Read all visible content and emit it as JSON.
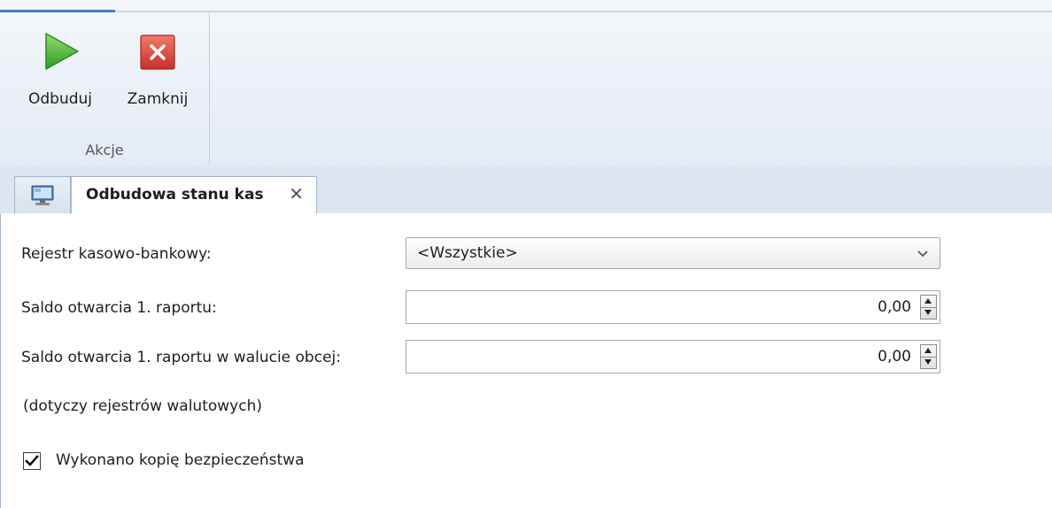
{
  "ribbon": {
    "buttons": {
      "rebuild": {
        "label": "Odbuduj",
        "icon": "play-icon"
      },
      "close": {
        "label": "Zamknij",
        "icon": "close-icon"
      }
    },
    "group_label": "Akcje"
  },
  "tabs": {
    "home_icon": "monitor-icon",
    "active": {
      "title": "Odbudowa stanu kas",
      "close_glyph": "✕"
    }
  },
  "form": {
    "register": {
      "label": "Rejestr kasowo-bankowy:",
      "value": "<Wszystkie>"
    },
    "opening_balance": {
      "label": "Saldo otwarcia 1. raportu:",
      "value": "0,00"
    },
    "opening_balance_foreign": {
      "label": "Saldo otwarcia 1. raportu w walucie obcej:",
      "value": "0,00"
    },
    "foreign_note": "(dotyczy rejestrów walutowych)",
    "backup": {
      "label": "Wykonano kopię bezpieczeństwa",
      "checked": true
    }
  },
  "colors": {
    "accent": "#3f7fc8",
    "play_green": "#4cbb3a",
    "close_red": "#d9453a"
  }
}
